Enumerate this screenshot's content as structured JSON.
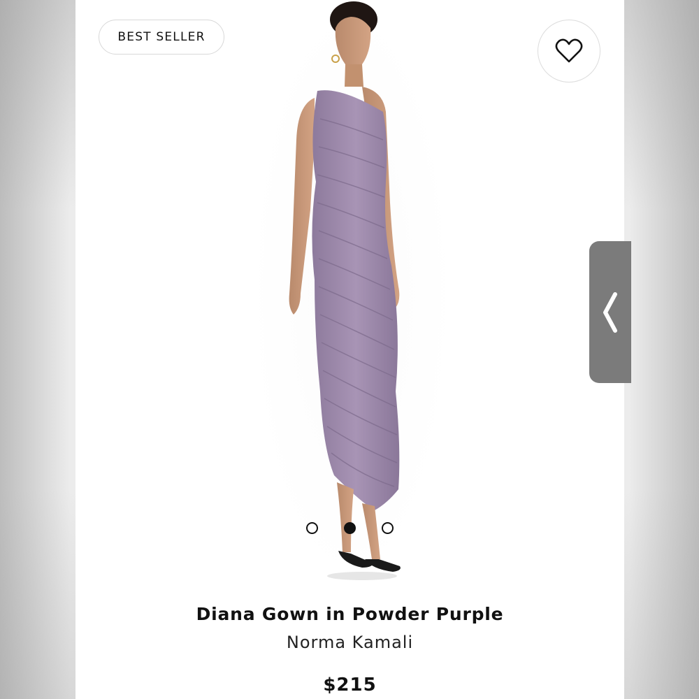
{
  "badge": {
    "label": "BEST SELLER"
  },
  "wishlist": {
    "icon": "heart-outline-icon"
  },
  "carousel": {
    "slide_count": 3,
    "active_index": 1
  },
  "product": {
    "name": "Diana Gown in Powder Purple",
    "brand": "Norma Kamali",
    "price": "$215",
    "dress_color": "#9c88a9"
  },
  "side_panel": {
    "icon": "chevron-left-icon"
  }
}
